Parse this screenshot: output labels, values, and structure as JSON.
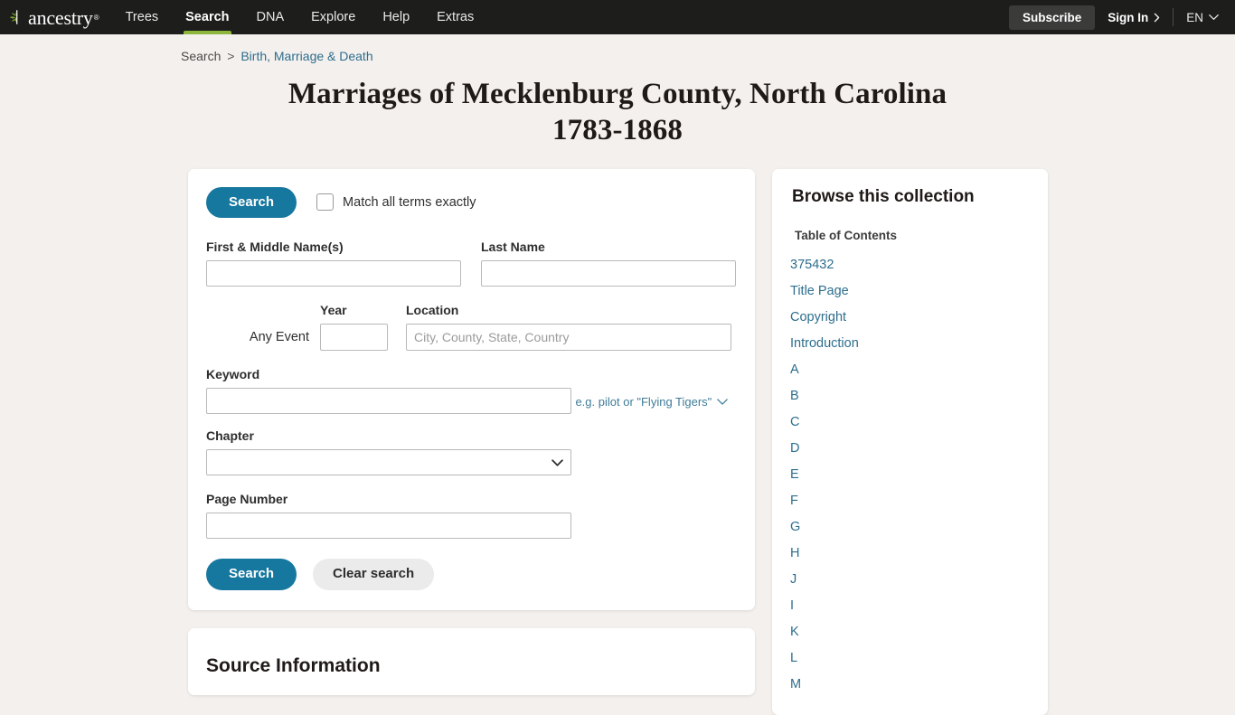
{
  "header": {
    "logo_text": "ancestry",
    "logo_tm": "®",
    "nav": [
      {
        "label": "Trees",
        "active": false
      },
      {
        "label": "Search",
        "active": true
      },
      {
        "label": "DNA",
        "active": false
      },
      {
        "label": "Explore",
        "active": false
      },
      {
        "label": "Help",
        "active": false
      },
      {
        "label": "Extras",
        "active": false
      }
    ],
    "subscribe_label": "Subscribe",
    "signin_label": "Sign In",
    "language_label": "EN",
    "accent_green": "#8cb63c",
    "bar_background": "#1d1d1b"
  },
  "breadcrumb": {
    "root": "Search",
    "separator": ">",
    "current": "Birth, Marriage & Death"
  },
  "page": {
    "title_line1": "Marriages of Mecklenburg County, North Carolina",
    "title_line2": "1783-1868",
    "background": "#f4f0ed",
    "accent_teal": "#17789f",
    "link_color": "#2d6e8e"
  },
  "search_form": {
    "search_top_label": "Search",
    "match_exactly_label": "Match all terms exactly",
    "match_exactly_checked": false,
    "first_name": {
      "label": "First & Middle Name(s)",
      "value": "",
      "placeholder": ""
    },
    "last_name": {
      "label": "Last Name",
      "value": "",
      "placeholder": ""
    },
    "event": {
      "row_label": "Any Event",
      "year_label": "Year",
      "year_value": "",
      "location_label": "Location",
      "location_value": "",
      "location_placeholder": "City, County, State, Country"
    },
    "keyword": {
      "label": "Keyword",
      "value": "",
      "placeholder": "",
      "hint": "e.g. pilot or \"Flying Tigers\""
    },
    "chapter": {
      "label": "Chapter",
      "selected": "",
      "options": [
        ""
      ]
    },
    "page_number": {
      "label": "Page Number",
      "value": "",
      "placeholder": ""
    },
    "submit_label": "Search",
    "clear_label": "Clear search"
  },
  "source_section": {
    "title": "Source Information"
  },
  "sidebar": {
    "title": "Browse this collection",
    "toc_label": "Table of Contents",
    "links": [
      "375432",
      "Title Page",
      "Copyright",
      "Introduction",
      "A",
      "B",
      "C",
      "D",
      "E",
      "F",
      "G",
      "H",
      "J",
      "I",
      "K",
      "L",
      "M"
    ]
  }
}
